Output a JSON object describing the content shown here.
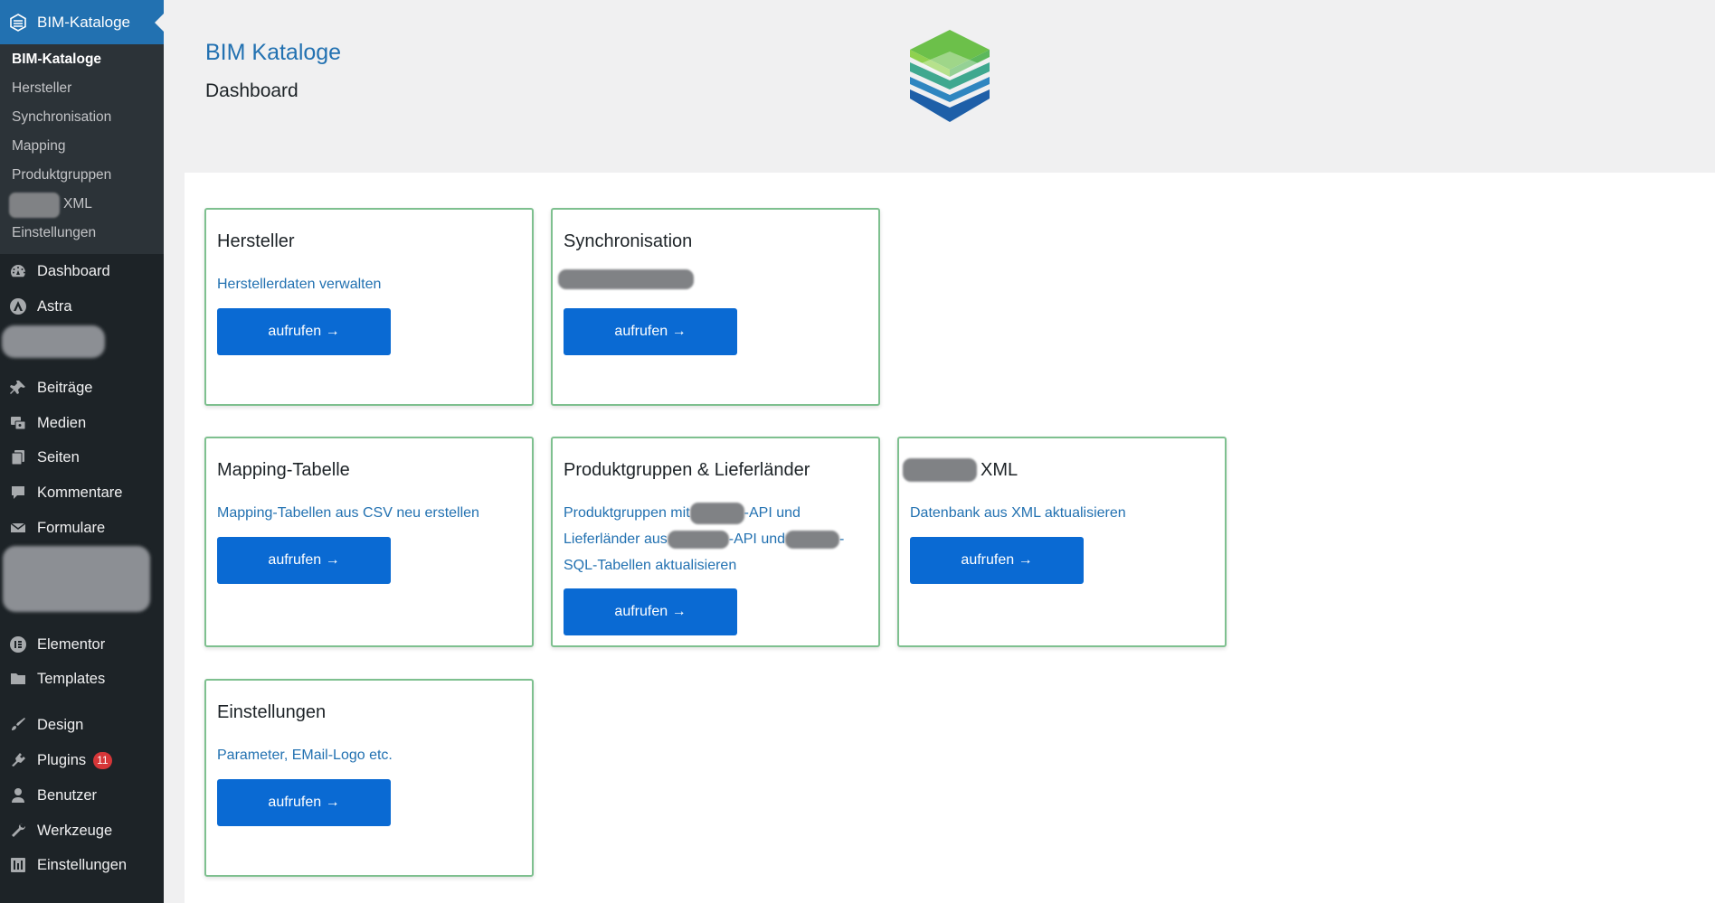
{
  "sidebar": {
    "active_plugin": "BIM-Kataloge",
    "submenu": [
      {
        "label": "BIM-Kataloge",
        "current": true
      },
      {
        "label": "Hersteller"
      },
      {
        "label": "Synchronisation"
      },
      {
        "label": "Mapping"
      },
      {
        "label": "Produktgruppen"
      },
      {
        "label": "XML"
      },
      {
        "label": "Einstellungen"
      }
    ],
    "menu": [
      {
        "label": "Dashboard",
        "icon": "dashboard-icon"
      },
      {
        "label": "Astra",
        "icon": "astra-icon"
      },
      {
        "label": "Beiträge",
        "icon": "pin-icon"
      },
      {
        "label": "Medien",
        "icon": "media-icon"
      },
      {
        "label": "Seiten",
        "icon": "pages-icon"
      },
      {
        "label": "Kommentare",
        "icon": "comment-icon"
      },
      {
        "label": "Formulare",
        "icon": "mail-icon"
      },
      {
        "label": "Elementor",
        "icon": "elementor-icon"
      },
      {
        "label": "Templates",
        "icon": "folder-icon"
      },
      {
        "label": "Design",
        "icon": "brush-icon"
      },
      {
        "label": "Plugins",
        "icon": "plugin-icon",
        "badge": "11"
      },
      {
        "label": "Benutzer",
        "icon": "user-icon"
      },
      {
        "label": "Werkzeuge",
        "icon": "wrench-icon"
      },
      {
        "label": "Einstellungen",
        "icon": "settings-icon"
      }
    ]
  },
  "header": {
    "plugin_title": "BIM Kataloge",
    "page_title": "Dashboard"
  },
  "colors": {
    "accent": "#2271b1",
    "button": "#0a6ad3",
    "card_border": "#7ec08f",
    "sidebar": "#1d2327",
    "badge": "#d63638"
  },
  "cards": [
    {
      "title": "Hersteller",
      "description": "Herstellerdaten verwalten",
      "button": "aufrufen →"
    },
    {
      "title": "Synchronisation",
      "description": "",
      "button": "aufrufen →"
    },
    {
      "title": "Mapping-Tabelle",
      "description": "Mapping-Tabellen aus CSV neu erstellen",
      "button": "aufrufen →"
    },
    {
      "title": "Produktgruppen & Lieferländer",
      "description_parts": [
        "Produktgruppen mit",
        "-API und",
        "Lieferländer aus",
        "-API und",
        "-",
        "SQL-Tabellen aktualisieren"
      ],
      "button": "aufrufen →"
    },
    {
      "title": "XML",
      "description": "Datenbank aus XML aktualisieren",
      "button": "aufrufen →"
    },
    {
      "title": "Einstellungen",
      "description": "Parameter, EMail-Logo etc.",
      "button": "aufrufen →"
    }
  ]
}
